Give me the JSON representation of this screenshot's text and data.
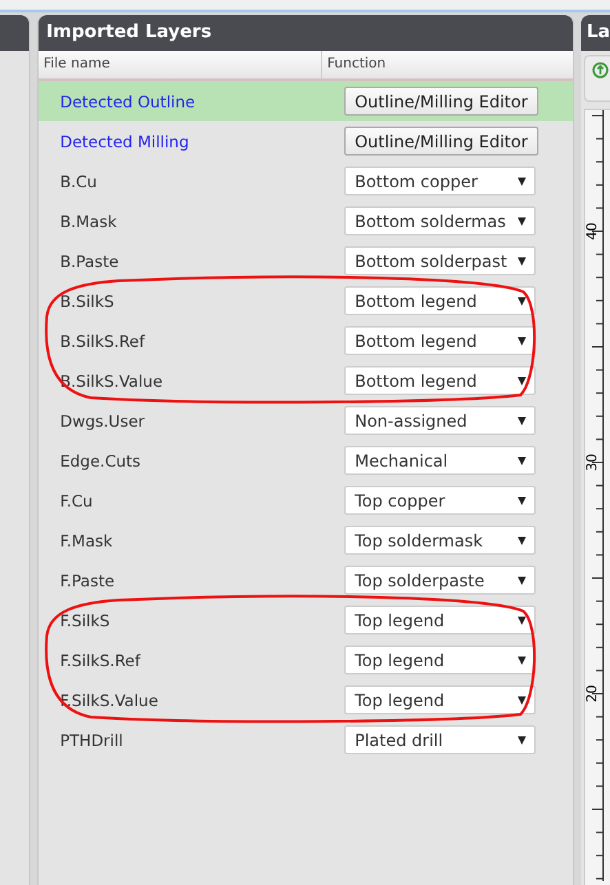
{
  "main_panel": {
    "title": "Imported Layers",
    "columns": [
      "File name",
      "Function"
    ],
    "rows": [
      {
        "kind": "detected",
        "name": "Detected Outline",
        "function": "Outline/Milling Editor",
        "selected": true,
        "circled": false
      },
      {
        "kind": "detected",
        "name": "Detected Milling",
        "function": "Outline/Milling Editor",
        "selected": false,
        "circled": false
      },
      {
        "kind": "layer",
        "name": "B.Cu",
        "function": "Bottom copper",
        "selected": false,
        "circled": false
      },
      {
        "kind": "layer",
        "name": "B.Mask",
        "function": "Bottom soldermas",
        "selected": false,
        "circled": false
      },
      {
        "kind": "layer",
        "name": "B.Paste",
        "function": "Bottom solderpast",
        "selected": false,
        "circled": false
      },
      {
        "kind": "layer",
        "name": "B.SilkS",
        "function": "Bottom legend",
        "selected": false,
        "circled": true
      },
      {
        "kind": "layer",
        "name": "B.SilkS.Ref",
        "function": "Bottom legend",
        "selected": false,
        "circled": true
      },
      {
        "kind": "layer",
        "name": "B.SilkS.Value",
        "function": "Bottom legend",
        "selected": false,
        "circled": true
      },
      {
        "kind": "layer",
        "name": "Dwgs.User",
        "function": "Non-assigned",
        "selected": false,
        "circled": false
      },
      {
        "kind": "layer",
        "name": "Edge.Cuts",
        "function": "Mechanical",
        "selected": false,
        "circled": false
      },
      {
        "kind": "layer",
        "name": "F.Cu",
        "function": "Top copper",
        "selected": false,
        "circled": false
      },
      {
        "kind": "layer",
        "name": "F.Mask",
        "function": "Top soldermask",
        "selected": false,
        "circled": false
      },
      {
        "kind": "layer",
        "name": "F.Paste",
        "function": "Top solderpaste",
        "selected": false,
        "circled": false
      },
      {
        "kind": "layer",
        "name": "F.SilkS",
        "function": "Top legend",
        "selected": false,
        "circled": true
      },
      {
        "kind": "layer",
        "name": "F.SilkS.Ref",
        "function": "Top legend",
        "selected": false,
        "circled": true
      },
      {
        "kind": "layer",
        "name": "F.SilkS.Value",
        "function": "Top legend",
        "selected": false,
        "circled": true
      },
      {
        "kind": "layer",
        "name": "PTHDrill",
        "function": "Plated drill",
        "selected": false,
        "circled": false
      }
    ]
  },
  "right_panel": {
    "title": "La",
    "ruler_labels": [
      "40",
      "30",
      "20"
    ]
  }
}
